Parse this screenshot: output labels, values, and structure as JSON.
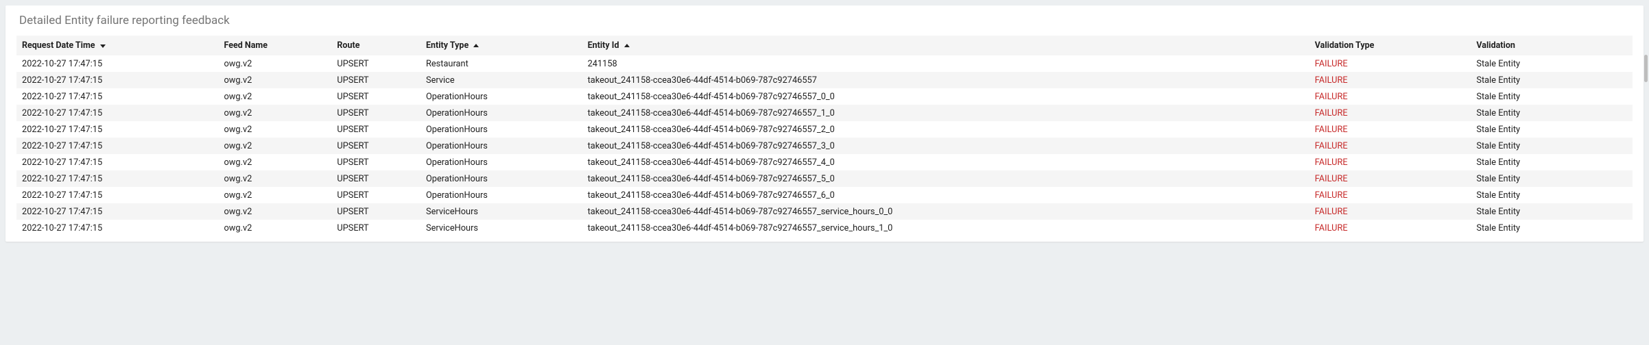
{
  "card": {
    "title": "Detailed Entity failure reporting feedback"
  },
  "columns": {
    "request_dt": "Request Date Time",
    "feed": "Feed Name",
    "route": "Route",
    "etype": "Entity Type",
    "eid": "Entity Id",
    "vtype": "Validation Type",
    "val": "Validation"
  },
  "rows": [
    {
      "request_dt": "2022-10-27 17:47:15",
      "feed": "owg.v2",
      "route": "UPSERT",
      "etype": "Restaurant",
      "eid": "241158",
      "vtype": "FAILURE",
      "val": "Stale Entity"
    },
    {
      "request_dt": "2022-10-27 17:47:15",
      "feed": "owg.v2",
      "route": "UPSERT",
      "etype": "Service",
      "eid": "takeout_241158-ccea30e6-44df-4514-b069-787c92746557",
      "vtype": "FAILURE",
      "val": "Stale Entity"
    },
    {
      "request_dt": "2022-10-27 17:47:15",
      "feed": "owg.v2",
      "route": "UPSERT",
      "etype": "OperationHours",
      "eid": "takeout_241158-ccea30e6-44df-4514-b069-787c92746557_0_0",
      "vtype": "FAILURE",
      "val": "Stale Entity"
    },
    {
      "request_dt": "2022-10-27 17:47:15",
      "feed": "owg.v2",
      "route": "UPSERT",
      "etype": "OperationHours",
      "eid": "takeout_241158-ccea30e6-44df-4514-b069-787c92746557_1_0",
      "vtype": "FAILURE",
      "val": "Stale Entity"
    },
    {
      "request_dt": "2022-10-27 17:47:15",
      "feed": "owg.v2",
      "route": "UPSERT",
      "etype": "OperationHours",
      "eid": "takeout_241158-ccea30e6-44df-4514-b069-787c92746557_2_0",
      "vtype": "FAILURE",
      "val": "Stale Entity"
    },
    {
      "request_dt": "2022-10-27 17:47:15",
      "feed": "owg.v2",
      "route": "UPSERT",
      "etype": "OperationHours",
      "eid": "takeout_241158-ccea30e6-44df-4514-b069-787c92746557_3_0",
      "vtype": "FAILURE",
      "val": "Stale Entity"
    },
    {
      "request_dt": "2022-10-27 17:47:15",
      "feed": "owg.v2",
      "route": "UPSERT",
      "etype": "OperationHours",
      "eid": "takeout_241158-ccea30e6-44df-4514-b069-787c92746557_4_0",
      "vtype": "FAILURE",
      "val": "Stale Entity"
    },
    {
      "request_dt": "2022-10-27 17:47:15",
      "feed": "owg.v2",
      "route": "UPSERT",
      "etype": "OperationHours",
      "eid": "takeout_241158-ccea30e6-44df-4514-b069-787c92746557_5_0",
      "vtype": "FAILURE",
      "val": "Stale Entity"
    },
    {
      "request_dt": "2022-10-27 17:47:15",
      "feed": "owg.v2",
      "route": "UPSERT",
      "etype": "OperationHours",
      "eid": "takeout_241158-ccea30e6-44df-4514-b069-787c92746557_6_0",
      "vtype": "FAILURE",
      "val": "Stale Entity"
    },
    {
      "request_dt": "2022-10-27 17:47:15",
      "feed": "owg.v2",
      "route": "UPSERT",
      "etype": "ServiceHours",
      "eid": "takeout_241158-ccea30e6-44df-4514-b069-787c92746557_service_hours_0_0",
      "vtype": "FAILURE",
      "val": "Stale Entity"
    },
    {
      "request_dt": "2022-10-27 17:47:15",
      "feed": "owg.v2",
      "route": "UPSERT",
      "etype": "ServiceHours",
      "eid": "takeout_241158-ccea30e6-44df-4514-b069-787c92746557_service_hours_1_0",
      "vtype": "FAILURE",
      "val": "Stale Entity"
    }
  ],
  "colors": {
    "failure": "#c62828"
  }
}
